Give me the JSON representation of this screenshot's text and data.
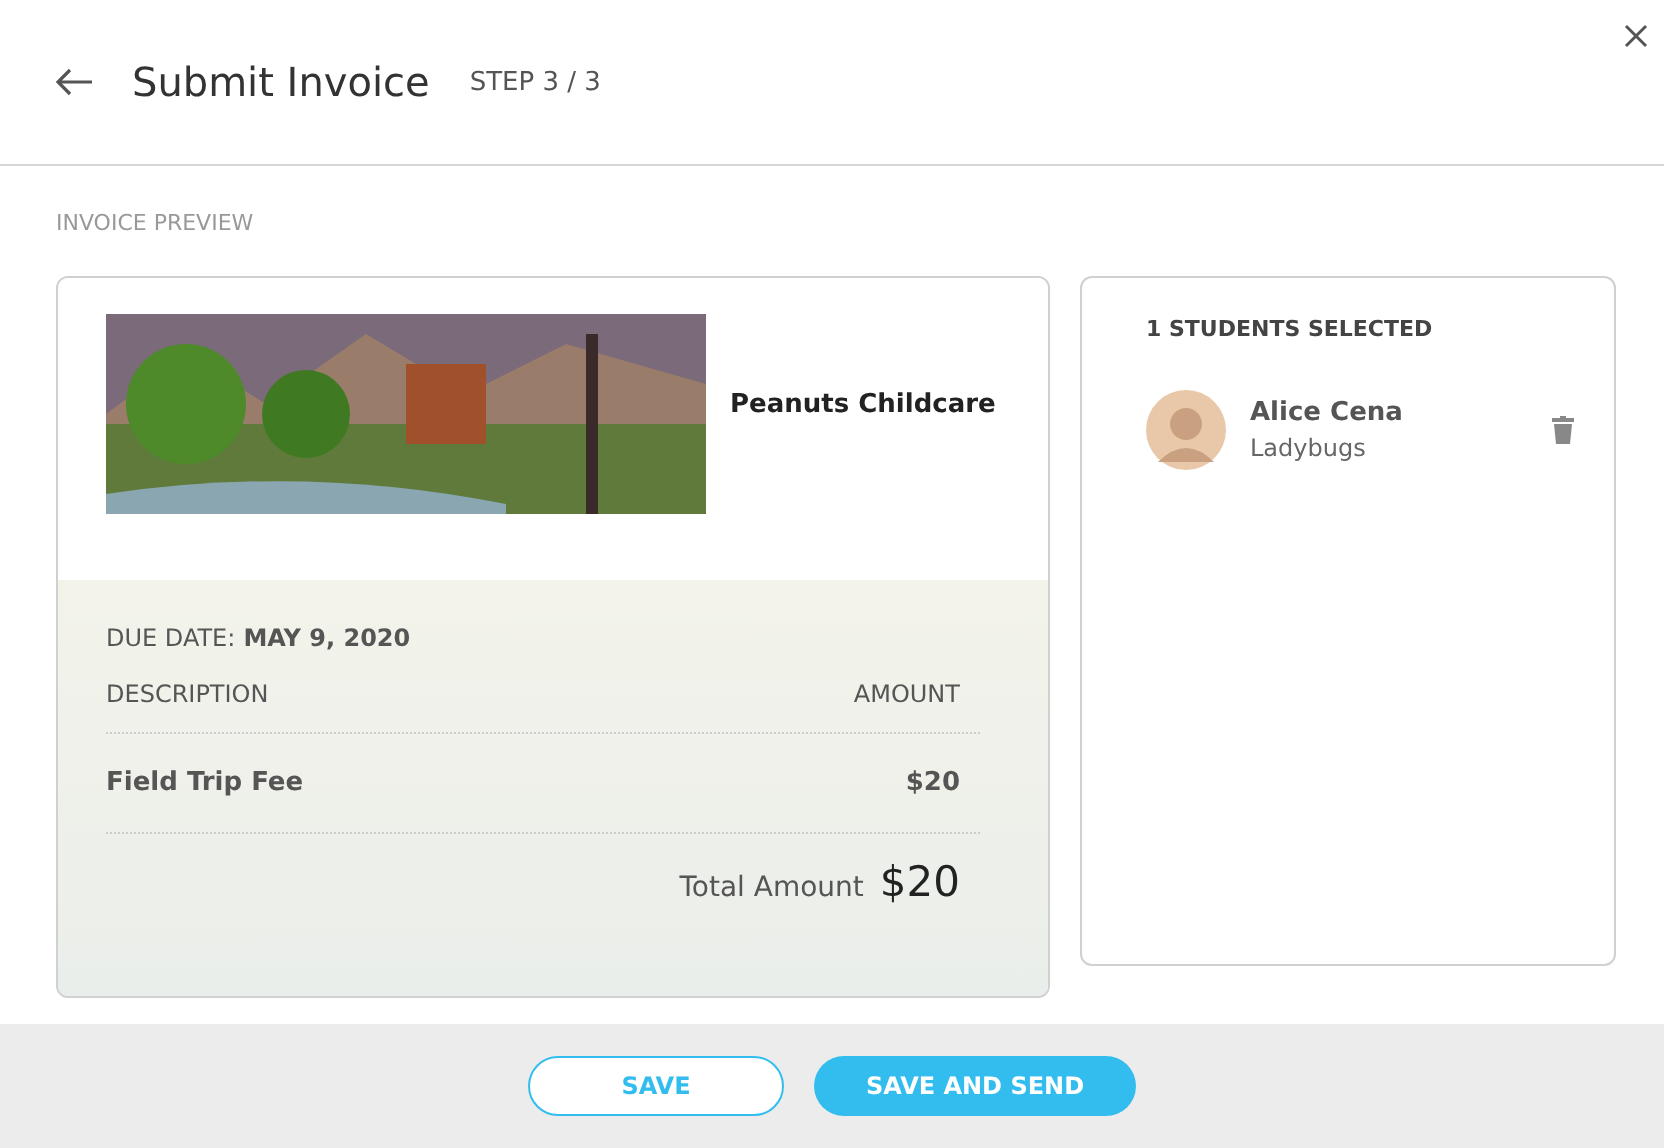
{
  "header": {
    "title": "Submit Invoice",
    "step": "STEP 3 / 3"
  },
  "section_label": "INVOICE PREVIEW",
  "invoice": {
    "school_name": "Peanuts Childcare",
    "due_label": "DUE DATE:",
    "due_date": "MAY 9, 2020",
    "columns": [
      "DESCRIPTION",
      "AMOUNT"
    ],
    "items": [
      {
        "description": "Field Trip Fee",
        "amount": "$20"
      }
    ],
    "total_label": "Total Amount",
    "total": "$20"
  },
  "students": {
    "heading": "1 STUDENTS SELECTED",
    "list": [
      {
        "name": "Alice Cena",
        "group": "Ladybugs"
      }
    ]
  },
  "buttons": [
    {
      "label": "SAVE",
      "kind": "outline"
    },
    {
      "label": "SAVE AND SEND",
      "kind": "primary"
    }
  ]
}
